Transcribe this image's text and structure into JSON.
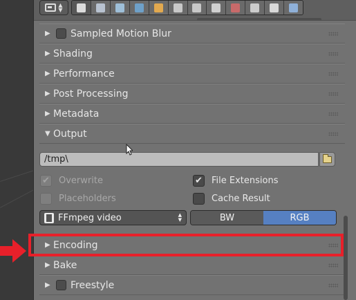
{
  "header": {
    "editor_menu_icon": "properties-editor-icon",
    "context_tabs": [
      {
        "name": "render-icon",
        "color": "#dcdcdc",
        "active": true
      },
      {
        "name": "render-layers-icon",
        "color": "#b8c2d0"
      },
      {
        "name": "scene-icon",
        "color": "#9ebfd8"
      },
      {
        "name": "world-icon",
        "color": "#6ea0c8"
      },
      {
        "name": "object-icon",
        "color": "#e2a94f"
      },
      {
        "name": "constraints-icon",
        "color": "#c8c8c8"
      },
      {
        "name": "modifiers-icon",
        "color": "#c8c8c8"
      },
      {
        "name": "data-icon",
        "color": "#d0d0d0"
      },
      {
        "name": "material-icon",
        "color": "#c86a6a"
      },
      {
        "name": "texture-icon",
        "color": "#cccccc"
      },
      {
        "name": "particles-icon",
        "color": "#d8d8d8"
      },
      {
        "name": "physics-icon",
        "color": "#8fb0d8"
      }
    ]
  },
  "panels": {
    "motion_blur": "Sampled Motion Blur",
    "shading": "Shading",
    "performance": "Performance",
    "post_processing": "Post Processing",
    "metadata": "Metadata",
    "output": "Output",
    "encoding": "Encoding",
    "bake": "Bake",
    "freestyle": "Freestyle"
  },
  "output": {
    "path": "/tmp\\",
    "overwrite": {
      "label": "Overwrite",
      "checked": true,
      "enabled": false
    },
    "placeholders": {
      "label": "Placeholders",
      "checked": false,
      "enabled": false
    },
    "file_extensions": {
      "label": "File Extensions",
      "checked": true
    },
    "cache_result": {
      "label": "Cache Result",
      "checked": false
    },
    "file_format": "FFmpeg video",
    "color_modes": [
      "BW",
      "RGB"
    ],
    "color_mode_selected": "RGB"
  },
  "colors": {
    "highlight": "#e8202a",
    "active_toggle": "#5680c2"
  }
}
